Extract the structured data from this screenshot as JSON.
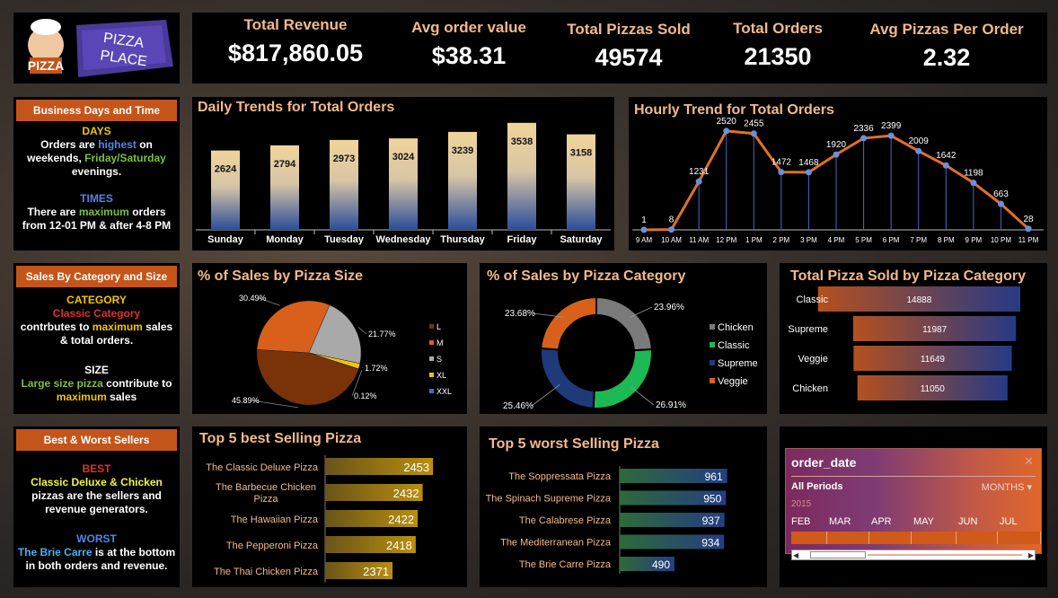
{
  "brand": {
    "logo_text": "PIZZA",
    "banner_line1": "PIZZA",
    "banner_line2": "PLACE"
  },
  "kpis": [
    {
      "label": "Total Revenue",
      "value": "$817,860.05"
    },
    {
      "label": "Avg order value",
      "value": "$38.31"
    },
    {
      "label": "Total Pizzas Sold",
      "value": "49574"
    },
    {
      "label": "Total Orders",
      "value": "21350"
    },
    {
      "label": "Avg Pizzas Per Order",
      "value": "2.32"
    }
  ],
  "info1": {
    "heading": "Business Days and Time",
    "days_head": "DAYS",
    "days_p1": "Orders are ",
    "days_hl": "highest",
    "days_p2": " on weekends, ",
    "days_hl2": "Friday/Saturday",
    "days_p3": " evenings.",
    "times_head": "TIMES",
    "times_p1": "There are ",
    "times_hl": "maximum",
    "times_p2": " orders from 12-01 PM & after 4-8 PM"
  },
  "info2": {
    "heading": "Sales By Category and Size",
    "cat_head": "CATEGORY",
    "cat_hl": "Classic Category",
    "cat_p1": "contrbutes to ",
    "cat_hl2": "maximum",
    "cat_p2": " sales & total orders.",
    "size_head": "SIZE",
    "size_hl": "Large size pizza",
    "size_p1": " contribute to ",
    "size_hl2": "maximum",
    "size_p2": " sales"
  },
  "info3": {
    "heading": "Best & Worst Sellers",
    "best_head": "BEST",
    "best_hl": "Classic Deluxe & Chicken",
    "best_p": "pizzas are the sellers and revenue generators.",
    "worst_head": "WORST",
    "worst_hl": "The Brie Carre",
    "worst_p": " is at the bottom in both orders and revenue."
  },
  "slicer": {
    "title": "order_date",
    "close": "✕",
    "periods": "All Periods",
    "months_label": "MONTHS ▾",
    "year": "2015",
    "months": [
      "FEB",
      "MAR",
      "APR",
      "MAY",
      "JUN",
      "JUL"
    ]
  },
  "colors": {
    "accent_orange": "#c4551a",
    "title_peach": "#f2b98a",
    "bar_blue": "#2a4d9a",
    "bar_tan": "#f0d49a",
    "line_orange": "#e07028",
    "pie_L": "#7a3308",
    "pie_M": "#d9601a",
    "pie_S": "#a9a9a9",
    "pie_XL": "#f5c400",
    "pie_XXL": "#3b6fd0",
    "cat_chicken": "#7a7a7a",
    "cat_classic": "#1db954",
    "cat_supreme": "#1f3a7a",
    "cat_veggie": "#d9601a"
  },
  "chart_data": [
    {
      "id": "daily",
      "type": "bar",
      "title": "Daily Trends for Total Orders",
      "categories": [
        "Sunday",
        "Monday",
        "Tuesday",
        "Wednesday",
        "Thursday",
        "Friday",
        "Saturday"
      ],
      "values": [
        2624,
        2794,
        2973,
        3024,
        3239,
        3538,
        3158
      ]
    },
    {
      "id": "hourly",
      "type": "line",
      "title": "Hourly Trend for Total Orders",
      "categories": [
        "9 AM",
        "10 AM",
        "11 AM",
        "12 PM",
        "1 PM",
        "2 PM",
        "3 PM",
        "4 PM",
        "5 PM",
        "6 PM",
        "7 PM",
        "8 PM",
        "9 PM",
        "10 PM",
        "11 PM"
      ],
      "values": [
        1,
        8,
        1231,
        2520,
        2455,
        1472,
        1468,
        1920,
        2336,
        2399,
        2009,
        1642,
        1198,
        663,
        28
      ]
    },
    {
      "id": "size",
      "type": "pie",
      "title": "% of  Sales by Pizza Size",
      "labels": [
        "L",
        "M",
        "S",
        "XL",
        "XXL"
      ],
      "values": [
        45.89,
        30.49,
        21.77,
        1.72,
        0.12
      ],
      "value_labels": [
        "45.89%",
        "30.49%",
        "21.77%",
        "1.72%",
        "0.12%"
      ]
    },
    {
      "id": "category",
      "type": "pie",
      "title": "% of  Sales by Pizza Category",
      "labels": [
        "Chicken",
        "Classic",
        "Supreme",
        "Veggie"
      ],
      "values": [
        23.96,
        26.91,
        25.46,
        23.68
      ],
      "value_labels": [
        "23.96%",
        "26.91%",
        "25.46%",
        "23.68%"
      ]
    },
    {
      "id": "sold_by_category",
      "type": "bar",
      "title": "Total Pizza Sold by Pizza Category",
      "categories": [
        "Classic",
        "Supreme",
        "Veggie",
        "Chicken"
      ],
      "values": [
        14888,
        11987,
        11649,
        11050
      ]
    },
    {
      "id": "top5",
      "type": "bar",
      "title": "Top 5 best Selling Pizza",
      "categories": [
        "The Classic Deluxe Pizza",
        "The Barbecue Chicken Pizza",
        "The Hawaiian Pizza",
        "The Pepperoni Pizza",
        "The Thai Chicken Pizza"
      ],
      "values": [
        2453,
        2432,
        2422,
        2418,
        2371
      ]
    },
    {
      "id": "worst5",
      "type": "bar",
      "title": "Top 5 worst Selling Pizza",
      "categories": [
        "The Soppressata Pizza",
        "The Spinach Supreme Pizza",
        "The Calabrese Pizza",
        "The Mediterranean Pizza",
        "The Brie Carre Pizza"
      ],
      "values": [
        961,
        950,
        937,
        934,
        490
      ]
    }
  ]
}
